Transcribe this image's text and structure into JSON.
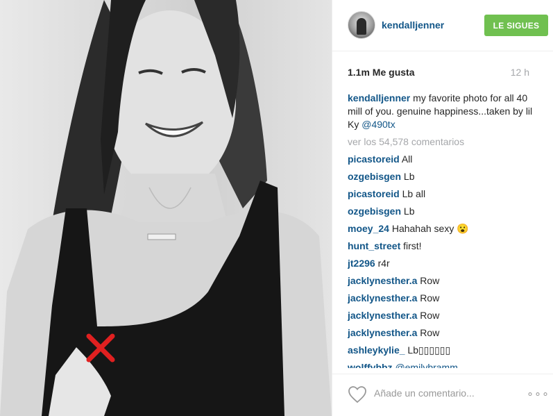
{
  "post": {
    "username": "kendalljenner",
    "follow_label": "LE SIGUES",
    "likes": "1.1m Me gusta",
    "time": "12 h",
    "caption_user": "kendalljenner",
    "caption_text": "my favorite photo for all 40 mill of you. genuine happiness...taken by lil Ky",
    "caption_mention": "@490tx",
    "more_comments": "ver los 54,578 comentarios"
  },
  "comments": [
    {
      "user": "picastoreid",
      "text": "All"
    },
    {
      "user": "ozgebisgen",
      "text": "Lb"
    },
    {
      "user": "picastoreid",
      "text": "Lb all"
    },
    {
      "user": "ozgebisgen",
      "text": "Lb"
    },
    {
      "user": "moey_24",
      "text": "Hahahah sexy 😮"
    },
    {
      "user": "hunt_street",
      "text": "first!"
    },
    {
      "user": "jt2296",
      "text": "r4r"
    },
    {
      "user": "jacklynesther.a",
      "text": "Row"
    },
    {
      "user": "jacklynesther.a",
      "text": "Row"
    },
    {
      "user": "jacklynesther.a",
      "text": "Row"
    },
    {
      "user": "jacklynesther.a",
      "text": "Row"
    },
    {
      "user": "ashleykylie_",
      "text": "Lb▯▯▯▯▯▯"
    },
    {
      "user": "wolffybbz",
      "text": "@emilybramm"
    }
  ],
  "footer": {
    "add_comment_placeholder": "Añade un comentario...",
    "more_options": "∘∘∘"
  },
  "colors": {
    "accent_link": "#125688",
    "follow_green": "#70c050",
    "censor_red": "#e02020"
  }
}
